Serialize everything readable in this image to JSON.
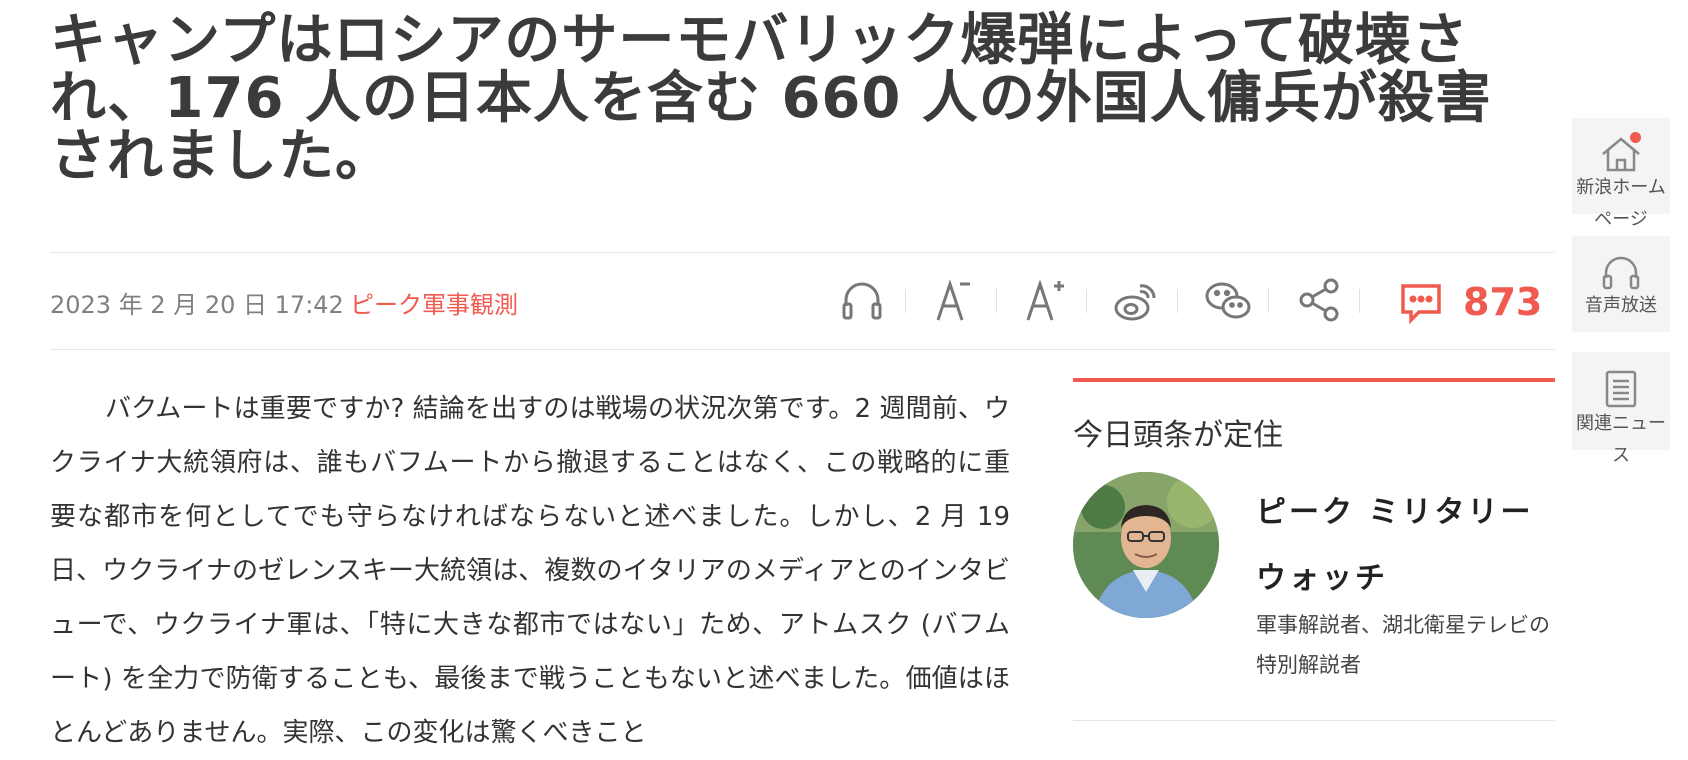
{
  "article": {
    "title": "キャンプはロシアのサーモバリック爆弾によって破壊され、176 人の日本人を含む 660 人の外国人傭兵が殺害されました。",
    "date": "2023 年 2 月 20 日 17:42",
    "source": "ピーク軍事観測",
    "body": "バクムートは重要ですか? 結論を出すのは戦場の状況次第です。2 週間前、ウクライナ大統領府は、誰もバフムートから撤退することはなく、この戦略的に重要な都市を何としてでも守らなければならないと述べました。しかし、2 月 19 日、ウクライナのゼレンスキー大統領は、複数のイタリアのメディアとのインタビューで、ウクライナ軍は、「特に大きな都市ではない」ため、アトムスク (バフムート) を全力で防衛することも、最後まで戦うこともないと述べました。価値はほとんどありません。実際、この変化は驚くべきこと"
  },
  "toolbar": {
    "icons": [
      "headphones-icon",
      "font-decrease-icon",
      "font-increase-icon",
      "weibo-icon",
      "wechat-icon",
      "share-icon",
      "comment-icon"
    ],
    "comment_count": "873"
  },
  "sidebar": {
    "title": "今日頭条が定住",
    "author_name": "ピーク ミリタリー ウォッチ",
    "author_desc": "軍事解説者、湖北衛星テレビの特別解説者"
  },
  "float_nav": {
    "home_label": "新浪ホームページ",
    "audio_label": "音声放送",
    "related_label": "関連ニュース"
  },
  "colors": {
    "accent": "#f05a4f",
    "title": "#3b3b3b",
    "meta": "#808080"
  }
}
